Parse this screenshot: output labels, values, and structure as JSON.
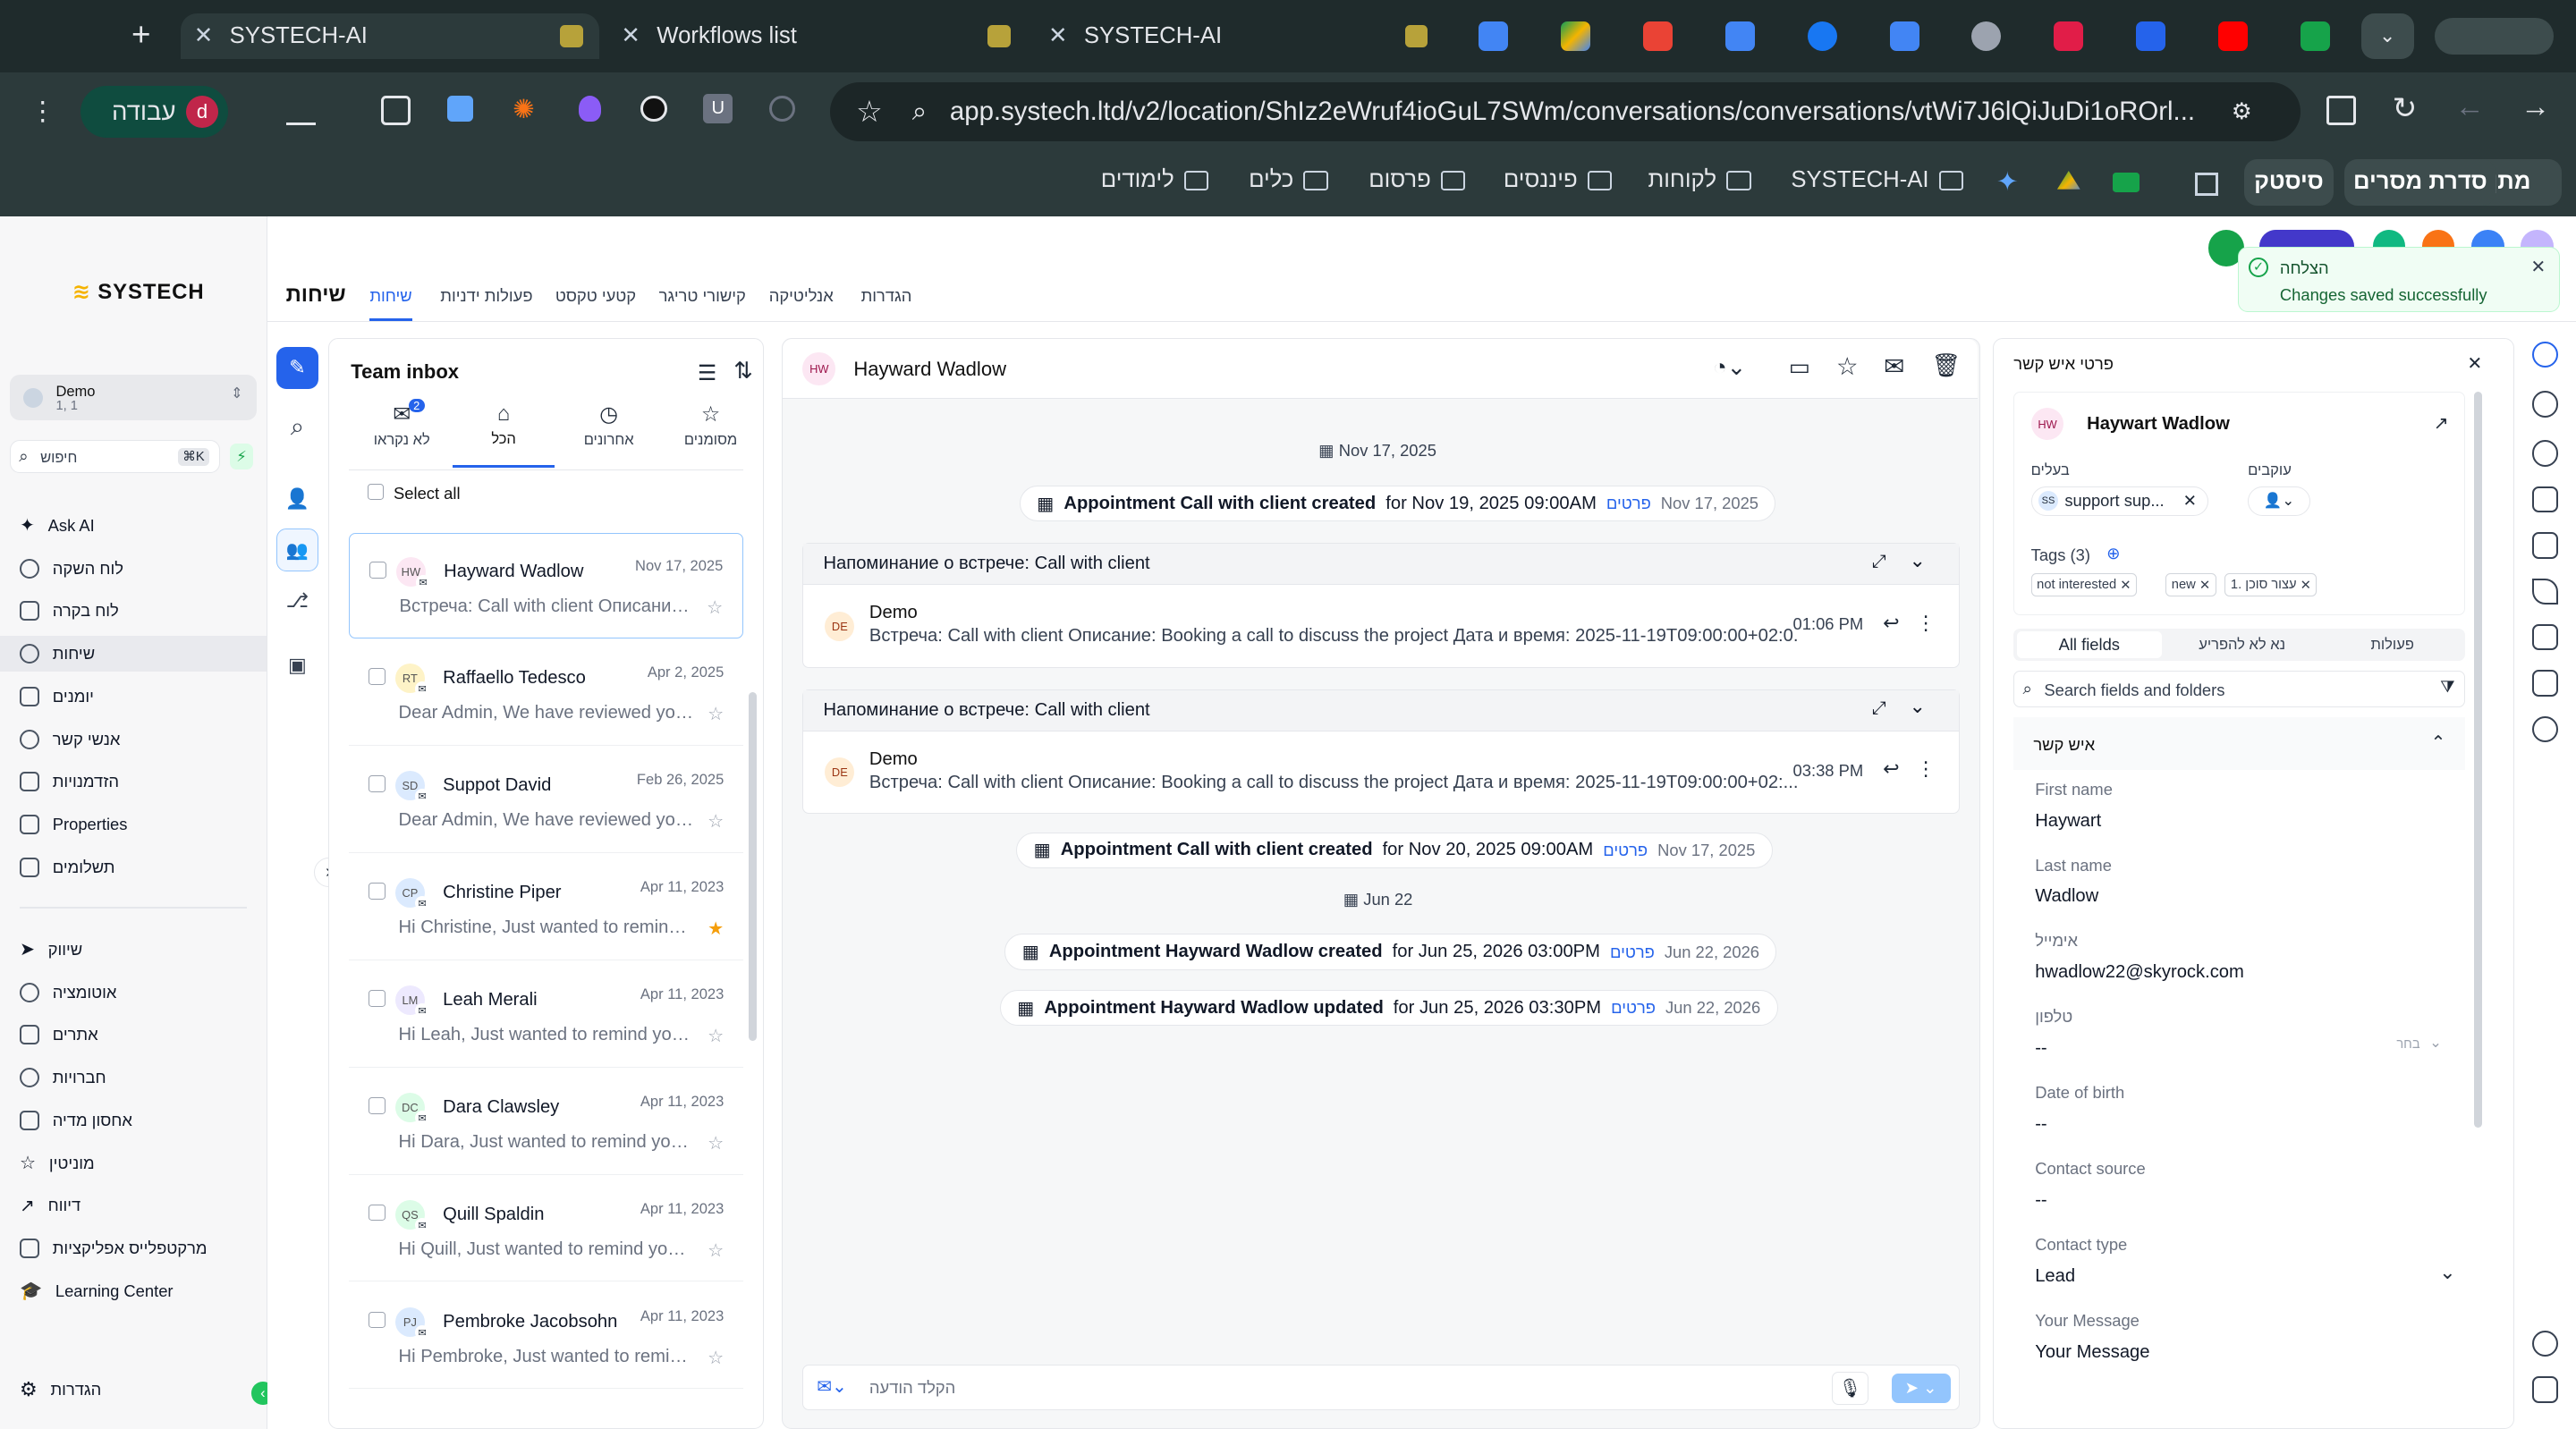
{
  "browser": {
    "tabs": [
      {
        "title": "SYSTECH-AI"
      },
      {
        "title": "Workflows list"
      },
      {
        "title": "SYSTECH-AI"
      }
    ],
    "profile_label": "עבודה",
    "profile_initial": "d",
    "url": "app.systech.ltd/v2/location/ShIz2eWruf4ioGuL7SWm/conversations/conversations/vtWi7J6lQiJuDi1oROrl...",
    "bookmarks": [
      "מתן",
      "סדרת מסרים",
      "סיסטק",
      "SYSTECH-AI",
      "לקוחות",
      "פיננסים",
      "פרסום",
      "כלים",
      "לימודים"
    ]
  },
  "brand": {
    "logo": "SYSTECH"
  },
  "sidebar": {
    "account_name": "Demo",
    "account_sub": "1, 1",
    "search_placeholder": "חיפוש",
    "search_shortcut": "⌘K",
    "items": [
      "Ask AI",
      "לוח השקה",
      "לוח בקרה",
      "שיחות",
      "יומנים",
      "אנשי קשר",
      "הזדמנויות",
      "Properties",
      "תשלומים",
      "שיווק",
      "אוטומציה",
      "אתרים",
      "חברויות",
      "אחסון מדיה",
      "מוניטין",
      "דיווח",
      "מרקטפלייס אפליקציות",
      "Learning Center"
    ],
    "settings": "הגדרות"
  },
  "topnav": {
    "title": "שיחות",
    "tabs": [
      "שיחות",
      "פעולות ידניות",
      "קטעי טקסט",
      "קישורי טריגר",
      "אנליטיקה",
      "הגדרות"
    ]
  },
  "toast": {
    "title": "הצלחה",
    "message": "Changes saved successfully"
  },
  "inbox": {
    "title": "Team inbox",
    "filters": [
      "לא נקראו",
      "הכל",
      "אחרונים",
      "מסומנים"
    ],
    "unread_badge": "2",
    "select_all": "Select all",
    "rows": [
      {
        "initials": "HW",
        "name": "Hayward Wadlow",
        "date": "Nov 17, 2025",
        "preview": "Встреча: Call with client Описание: Booking a call",
        "star": "☆"
      },
      {
        "initials": "RT",
        "name": "Raffaello Tedesco",
        "date": "Apr 2, 2025",
        "preview": "Dear Admin, We have reviewed your account",
        "star": "☆"
      },
      {
        "initials": "SD",
        "name": "Suppot David",
        "date": "Feb 26, 2025",
        "preview": "Dear Admin, We have reviewed your account",
        "star": "☆"
      },
      {
        "initials": "CP",
        "name": "Christine Piper",
        "date": "Apr 11, 2023",
        "preview": "Hi Christine, Just wanted to remind you",
        "star": "★"
      },
      {
        "initials": "LM",
        "name": "Leah Merali",
        "date": "Apr 11, 2023",
        "preview": "Hi Leah, Just wanted to remind you about",
        "star": "☆"
      },
      {
        "initials": "DC",
        "name": "Dara Clawsley",
        "date": "Apr 11, 2023",
        "preview": "Hi Dara, Just wanted to remind you about",
        "star": "☆"
      },
      {
        "initials": "QS",
        "name": "Quill Spaldin",
        "date": "Apr 11, 2023",
        "preview": "Hi Quill, Just wanted to remind you about",
        "star": "☆"
      },
      {
        "initials": "PJ",
        "name": "Pembroke Jacobsohn",
        "date": "Apr 11, 2023",
        "preview": "Hi Pembroke, Just wanted to remind you",
        "star": "☆"
      }
    ]
  },
  "conversation": {
    "initials": "HW",
    "name": "Hayward Wadlow",
    "date1": "Nov 17, 2025",
    "evt1": {
      "bold": "Appointment Call with client created",
      "rest": "for Nov 19, 2025 09:00AM",
      "link": "פרטים",
      "date": "Nov 17, 2025"
    },
    "card1": {
      "header": "Напоминание о встрече: Call with client",
      "sender": "Demo",
      "avatar": "DE",
      "text": "Встреча: Call with client Описание: Booking a call to discuss the project Дата и время: 2025-11-19T09:00:00+02:0...",
      "time": "01:06 PM"
    },
    "card2": {
      "header": "Напоминание о встрече: Call with client",
      "sender": "Demo",
      "avatar": "DE",
      "text": "Встреча: Call with client Описание: Booking a call to discuss the project Дата и время: 2025-11-19T09:00:00+02:...",
      "time": "03:38 PM"
    },
    "evt2": {
      "bold": "Appointment Call with client created",
      "rest": "for Nov 20, 2025 09:00AM",
      "link": "פרטים",
      "date": "Nov 17, 2025"
    },
    "date2": "Jun 22",
    "evt3": {
      "bold": "Appointment Hayward Wadlow created",
      "rest": "for Jun 25, 2026 03:00PM",
      "link": "פרטים",
      "date": "Jun 22, 2026"
    },
    "evt4": {
      "bold": "Appointment Hayward Wadlow updated",
      "rest": "for Jun 25, 2026 03:30PM",
      "link": "פרטים",
      "date": "Jun 22, 2026"
    },
    "composer_placeholder": "הקלד הודעה"
  },
  "contact": {
    "panel_title": "פרטי איש קשר",
    "initials": "HW",
    "name": "Haywart Wadlow",
    "owner_label": "בעלים",
    "owner_value": "support sup...",
    "followers_label": "עוקבים",
    "tags_label": "Tags (3)",
    "tags": [
      "not interested",
      "new",
      "1. עצור סוכן"
    ],
    "tabs": [
      "All fields",
      "נא לא להפריע",
      "פעולות"
    ],
    "search_placeholder": "Search fields and folders",
    "section": "איש קשר",
    "fields": [
      {
        "label": "First name",
        "value": "Haywart"
      },
      {
        "label": "Last name",
        "value": "Wadlow"
      },
      {
        "label": "אימייל",
        "value": "hwadlow22@skyrock.com"
      },
      {
        "label": "טלפון",
        "value": "--"
      },
      {
        "label": "Date of birth",
        "value": "--"
      },
      {
        "label": "Contact source",
        "value": "--"
      },
      {
        "label": "Contact type",
        "value": "Lead"
      },
      {
        "label": "Your Message",
        "value": "Your Message"
      }
    ],
    "phone_select": "בחר"
  }
}
